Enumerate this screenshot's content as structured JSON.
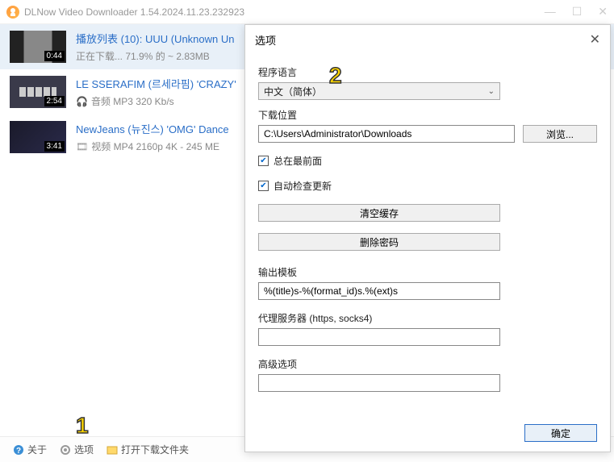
{
  "titlebar": {
    "title": "DLNow Video Downloader 1.54.2024.11.23.232923"
  },
  "downloads": [
    {
      "duration": "0:44",
      "title": "播放列表 (10): UUU (Unknown Un",
      "meta1": "正在下载...  71.9% 的 ~    2.83MB"
    },
    {
      "duration": "2:54",
      "title": "LE SSERAFIM (르세라핌) 'CRAZY'",
      "meta1": "音频 MP3 320 Kb/s"
    },
    {
      "duration": "3:41",
      "title": "NewJeans (뉴진스) 'OMG' Dance",
      "meta1": "视频 MP4 2160p 4K - 245 ME"
    }
  ],
  "bottombar": {
    "about": "关于",
    "options": "选项",
    "openfolder": "打开下载文件夹"
  },
  "dialog": {
    "title": "选项",
    "lang_label": "程序语言",
    "lang_value": "中文（简体）",
    "path_label": "下载位置",
    "path_value": "C:\\Users\\Administrator\\Downloads",
    "browse": "浏览...",
    "always_top": "总在最前面",
    "auto_update": "自动检查更新",
    "clear_cache": "清空缓存",
    "delete_password": "删除密码",
    "output_template_label": "输出模板",
    "output_template_value": "%(title)s-%(format_id)s.%(ext)s",
    "proxy_label": "代理服务器 (https, socks4)",
    "advanced_label": "高级选项",
    "ok": "确定"
  },
  "annotations": {
    "a1": "1",
    "a2": "2"
  }
}
